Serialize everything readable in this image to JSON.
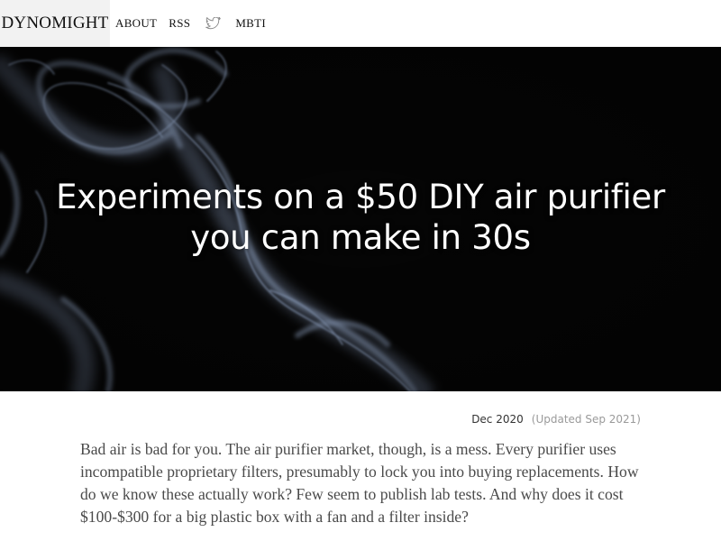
{
  "nav": {
    "brand": "DYNOMIGHT",
    "links": [
      {
        "label": "ABOUT"
      },
      {
        "label": "RSS"
      },
      {
        "icon": "twitter-icon"
      },
      {
        "label": "MBTI"
      }
    ]
  },
  "hero": {
    "title_line1": "Experiments on a $50 DIY air purifier",
    "title_line2": "you can make in 30s",
    "background_icon": "smoke-image"
  },
  "meta": {
    "date": "Dec 2020",
    "updated": "(Updated Sep 2021)"
  },
  "article": {
    "intro": "Bad air is bad for you. The air purifier market, though, is a mess. Every purifier uses incompatible proprietary filters, presumably to lock you into buying replacements. How do we know these actually work? Few seem to publish lab tests. And why does it cost $100-$300 for a big plastic box with a fan and a filter inside?"
  },
  "colors": {
    "hero_bg": "#050505",
    "smoke": "#9fb3d6",
    "brand_bg": "#f2f2f2",
    "text": "#4a4a4a"
  }
}
